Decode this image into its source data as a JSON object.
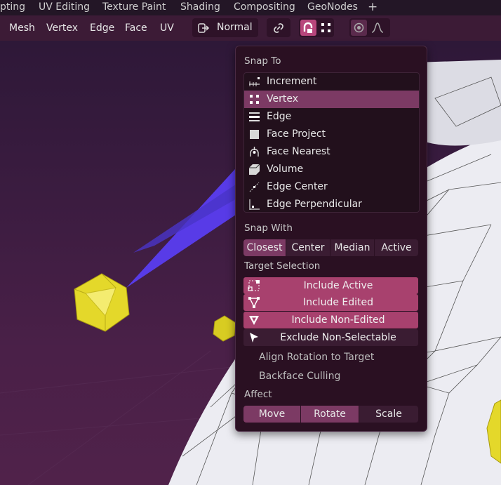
{
  "workspace_tabs": [
    "pting",
    "UV Editing",
    "Texture Paint",
    "Shading",
    "Compositing",
    "GeoNodes",
    "+"
  ],
  "header": {
    "menus": [
      "Mesh",
      "Vertex",
      "Edge",
      "Face",
      "UV"
    ],
    "orientation": "Normal"
  },
  "popup": {
    "snap_to_label": "Snap To",
    "snap_to_items": [
      {
        "label": "Increment",
        "icon": "increment-icon",
        "selected": false
      },
      {
        "label": "Vertex",
        "icon": "vertex-icon",
        "selected": true
      },
      {
        "label": "Edge",
        "icon": "edge-icon",
        "selected": false
      },
      {
        "label": "Face Project",
        "icon": "face-project-icon",
        "selected": false
      },
      {
        "label": "Face Nearest",
        "icon": "face-nearest-icon",
        "selected": false
      },
      {
        "label": "Volume",
        "icon": "volume-icon",
        "selected": false
      },
      {
        "label": "Edge Center",
        "icon": "edge-center-icon",
        "selected": false
      },
      {
        "label": "Edge Perpendicular",
        "icon": "edge-perpendicular-icon",
        "selected": false
      }
    ],
    "snap_with_label": "Snap With",
    "snap_with_options": [
      {
        "label": "Closest",
        "selected": true
      },
      {
        "label": "Center",
        "selected": false
      },
      {
        "label": "Median",
        "selected": false
      },
      {
        "label": "Active",
        "selected": false
      }
    ],
    "target_selection_label": "Target Selection",
    "target_selection": [
      {
        "label": "Include Active",
        "on": true
      },
      {
        "label": "Include Edited",
        "on": true
      },
      {
        "label": "Include Non-Edited",
        "on": true
      },
      {
        "label": "Exclude Non-Selectable",
        "on": false
      }
    ],
    "align_rotation_label": "Align Rotation to Target",
    "backface_culling_label": "Backface Culling",
    "affect_label": "Affect",
    "affect_options": [
      {
        "label": "Move",
        "selected": true
      },
      {
        "label": "Rotate",
        "selected": true
      },
      {
        "label": "Scale",
        "selected": false
      }
    ]
  },
  "colors": {
    "accent": "#a8416e",
    "selected": "#7c3a64"
  }
}
